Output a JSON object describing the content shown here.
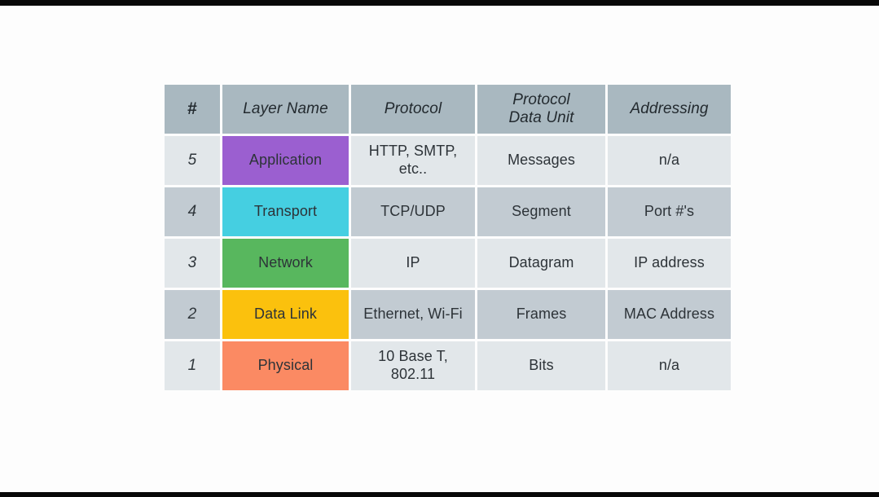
{
  "slide": {
    "kind": "osi-layer-table",
    "background_color": "#fdfdfd",
    "letterbox_color": "#080808"
  },
  "table": {
    "header_background": "#a9b8c0",
    "row_light_background": "#e2e7ea",
    "row_dark_background": "#c2cbd2",
    "columns": [
      {
        "key": "num",
        "label": "#"
      },
      {
        "key": "layer",
        "label": "Layer Name"
      },
      {
        "key": "proto",
        "label": "Protocol"
      },
      {
        "key": "pdu",
        "label_line1": "Protocol",
        "label_line2": "Data Unit"
      },
      {
        "key": "addr",
        "label": "Addressing"
      }
    ],
    "rows": [
      {
        "num": "5",
        "layer": "Application",
        "layer_color": "#9b5fd0",
        "proto_line1": "HTTP, SMTP,",
        "proto_line2": "etc..",
        "pdu": "Messages",
        "addr": "n/a",
        "shade": "light"
      },
      {
        "num": "4",
        "layer": "Transport",
        "layer_color": "#45cfe1",
        "proto_line1": "TCP/UDP",
        "proto_line2": "",
        "pdu": "Segment",
        "addr": "Port #'s",
        "shade": "dark"
      },
      {
        "num": "3",
        "layer": "Network",
        "layer_color": "#58b75e",
        "proto_line1": "IP",
        "proto_line2": "",
        "pdu": "Datagram",
        "addr": "IP address",
        "shade": "light"
      },
      {
        "num": "2",
        "layer": "Data Link",
        "layer_color": "#fbc10d",
        "proto_line1": "Ethernet, Wi-Fi",
        "proto_line2": "",
        "pdu": "Frames",
        "addr": "MAC Address",
        "shade": "dark"
      },
      {
        "num": "1",
        "layer": "Physical",
        "layer_color": "#fb8a63",
        "proto_line1": "10 Base T,",
        "proto_line2": "802.11",
        "pdu": "Bits",
        "addr": "n/a",
        "shade": "light"
      }
    ]
  }
}
